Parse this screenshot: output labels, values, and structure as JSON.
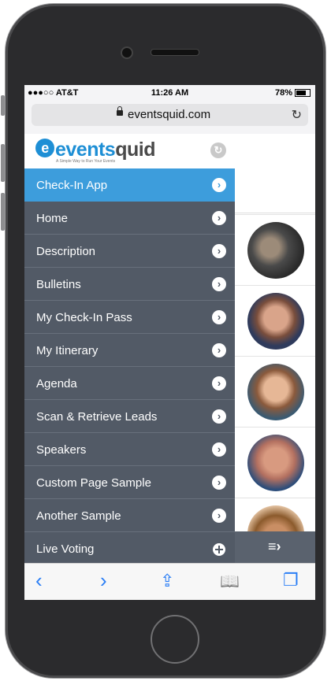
{
  "status": {
    "carrier": "●●●○○ AT&T",
    "time": "11:26 AM",
    "battery": "78%"
  },
  "browser": {
    "url": "eventsquid.com"
  },
  "logo": {
    "part1": "events",
    "part2": "quid",
    "tagline": "A Simple Way to Run Your Events"
  },
  "menu": {
    "items": [
      {
        "label": "Check-In App"
      },
      {
        "label": "Home"
      },
      {
        "label": "Description"
      },
      {
        "label": "Bulletins"
      },
      {
        "label": "My Check-In Pass"
      },
      {
        "label": "My Itinerary"
      },
      {
        "label": "Agenda"
      },
      {
        "label": "Scan & Retrieve Leads"
      },
      {
        "label": "Speakers"
      },
      {
        "label": "Custom Page Sample"
      },
      {
        "label": "Another Sample"
      },
      {
        "label": "Live Voting"
      }
    ]
  },
  "icons": {
    "chevron": "›",
    "reload": "↻",
    "refresh_g": "↻",
    "back": "‹",
    "forward": "›",
    "share": "⇪",
    "bookmarks": "📖",
    "tabs": "❐",
    "drawer": "≡›"
  },
  "colors": {
    "active": "#3d9ddc",
    "menu_bg": "#525a66",
    "brand": "#1e8fd5"
  }
}
